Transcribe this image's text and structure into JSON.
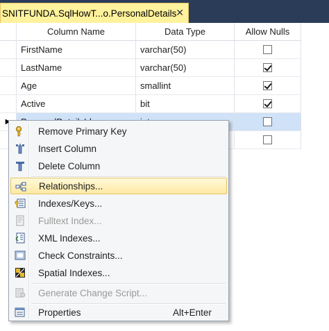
{
  "tab": {
    "title": "SNITFUNDA.SqlHowT...o.PersonalDetails",
    "close_glyph": "✕"
  },
  "grid": {
    "headers": [
      "Column Name",
      "Data Type",
      "Allow Nulls"
    ],
    "rows": [
      {
        "name": "FirstName",
        "type": "varchar(50)",
        "allow_nulls": false
      },
      {
        "name": "LastName",
        "type": "varchar(50)",
        "allow_nulls": true
      },
      {
        "name": "Age",
        "type": "smallint",
        "allow_nulls": true
      },
      {
        "name": "Active",
        "type": "bit",
        "allow_nulls": true
      },
      {
        "name": "PersonalDetailsId",
        "type": "int",
        "allow_nulls": false,
        "selected": true,
        "marker": "▶"
      },
      {
        "name": "",
        "type": "",
        "allow_nulls": false
      }
    ]
  },
  "context_menu": {
    "items": [
      {
        "label": "Remove Primary Key",
        "icon": "key-icon",
        "enabled": true
      },
      {
        "label": "Insert Column",
        "icon": "insert-column-icon",
        "enabled": true
      },
      {
        "label": "Delete Column",
        "icon": "delete-column-icon",
        "enabled": true
      },
      {
        "label": "Relationships...",
        "icon": "relationships-icon",
        "enabled": true,
        "highlighted": true
      },
      {
        "label": "Indexes/Keys...",
        "icon": "indexes-keys-icon",
        "enabled": true
      },
      {
        "label": "Fulltext Index...",
        "icon": "fulltext-index-icon",
        "enabled": false
      },
      {
        "label": "XML Indexes...",
        "icon": "xml-indexes-icon",
        "enabled": true
      },
      {
        "label": "Check Constraints...",
        "icon": "check-constraints-icon",
        "enabled": true
      },
      {
        "label": "Spatial Indexes...",
        "icon": "spatial-indexes-icon",
        "enabled": true
      },
      {
        "label": "Generate Change Script...",
        "icon": "generate-script-icon",
        "enabled": false
      },
      {
        "label": "Properties",
        "icon": "properties-icon",
        "enabled": true,
        "shortcut": "Alt+Enter"
      }
    ]
  },
  "colors": {
    "tab_background": "#fff29d",
    "tabstrip_background": "#2b3c59",
    "selected_row": "#cfe2f7",
    "menu_highlight": "#ffe9a4"
  }
}
